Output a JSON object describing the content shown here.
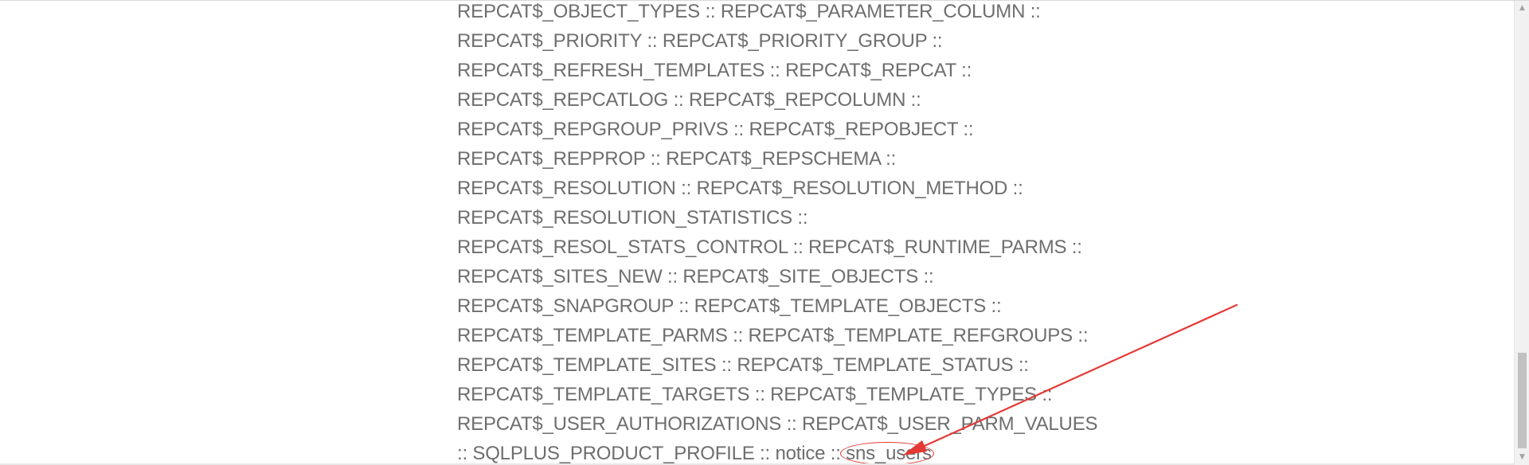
{
  "table_list": {
    "lines": [
      "REPCAT$_OBJECT_TYPES :: REPCAT$_PARAMETER_COLUMN ::",
      "REPCAT$_PRIORITY :: REPCAT$_PRIORITY_GROUP ::",
      "REPCAT$_REFRESH_TEMPLATES :: REPCAT$_REPCAT ::",
      "REPCAT$_REPCATLOG :: REPCAT$_REPCOLUMN ::",
      "REPCAT$_REPGROUP_PRIVS :: REPCAT$_REPOBJECT ::",
      "REPCAT$_REPPROP :: REPCAT$_REPSCHEMA ::",
      "REPCAT$_RESOLUTION :: REPCAT$_RESOLUTION_METHOD ::",
      "REPCAT$_RESOLUTION_STATISTICS ::",
      "REPCAT$_RESOL_STATS_CONTROL :: REPCAT$_RUNTIME_PARMS ::",
      "REPCAT$_SITES_NEW :: REPCAT$_SITE_OBJECTS ::",
      "REPCAT$_SNAPGROUP :: REPCAT$_TEMPLATE_OBJECTS ::",
      "REPCAT$_TEMPLATE_PARMS :: REPCAT$_TEMPLATE_REFGROUPS ::",
      "REPCAT$_TEMPLATE_SITES :: REPCAT$_TEMPLATE_STATUS ::",
      "REPCAT$_TEMPLATE_TARGETS :: REPCAT$_TEMPLATE_TYPES ::",
      "REPCAT$_USER_AUTHORIZATIONS :: REPCAT$_USER_PARM_VALUES"
    ],
    "last_line_prefix": ":: SQLPLUS_PRODUCT_PROFILE :: notice :: ",
    "highlighted_item": "sns_users"
  },
  "annotation": {
    "color": "#e53935",
    "shape": "ellipse-and-arrow"
  },
  "scrollbar": {
    "up_icon": "chevron-up-icon",
    "down_icon": "chevron-down-icon"
  }
}
